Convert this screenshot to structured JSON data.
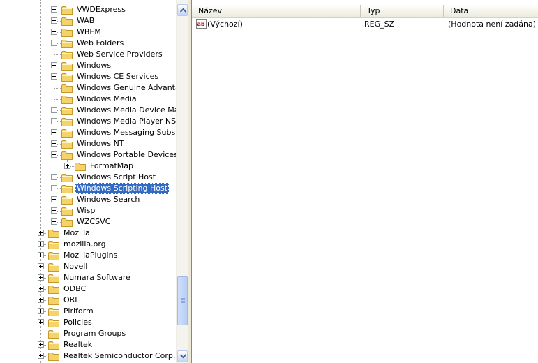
{
  "tree": {
    "nodes": [
      {
        "label": "VWDExpress",
        "depth": 2,
        "expander": "plus"
      },
      {
        "label": "WAB",
        "depth": 2,
        "expander": "plus"
      },
      {
        "label": "WBEM",
        "depth": 2,
        "expander": "plus"
      },
      {
        "label": "Web Folders",
        "depth": 2,
        "expander": "plus"
      },
      {
        "label": "Web Service Providers",
        "depth": 2,
        "expander": "none"
      },
      {
        "label": "Windows",
        "depth": 2,
        "expander": "plus"
      },
      {
        "label": "Windows CE Services",
        "depth": 2,
        "expander": "plus"
      },
      {
        "label": "Windows Genuine Advantage",
        "depth": 2,
        "expander": "none"
      },
      {
        "label": "Windows Media",
        "depth": 2,
        "expander": "none"
      },
      {
        "label": "Windows Media Device Manag",
        "depth": 2,
        "expander": "plus"
      },
      {
        "label": "Windows Media Player NSS",
        "depth": 2,
        "expander": "plus"
      },
      {
        "label": "Windows Messaging Subsyste",
        "depth": 2,
        "expander": "plus"
      },
      {
        "label": "Windows NT",
        "depth": 2,
        "expander": "plus"
      },
      {
        "label": "Windows Portable Devices",
        "depth": 2,
        "expander": "minus"
      },
      {
        "label": "FormatMap",
        "depth": 3,
        "expander": "plus"
      },
      {
        "label": "Windows Script Host",
        "depth": 2,
        "expander": "plus"
      },
      {
        "label": "Windows Scripting Host",
        "depth": 2,
        "expander": "plus",
        "selected": true
      },
      {
        "label": "Windows Search",
        "depth": 2,
        "expander": "plus"
      },
      {
        "label": "Wisp",
        "depth": 2,
        "expander": "plus"
      },
      {
        "label": "WZCSVC",
        "depth": 2,
        "expander": "plus"
      },
      {
        "label": "Mozilla",
        "depth": 1,
        "expander": "plus"
      },
      {
        "label": "mozilla.org",
        "depth": 1,
        "expander": "plus"
      },
      {
        "label": "MozillaPlugins",
        "depth": 1,
        "expander": "plus"
      },
      {
        "label": "Novell",
        "depth": 1,
        "expander": "plus"
      },
      {
        "label": "Numara Software",
        "depth": 1,
        "expander": "plus"
      },
      {
        "label": "ODBC",
        "depth": 1,
        "expander": "plus"
      },
      {
        "label": "ORL",
        "depth": 1,
        "expander": "plus"
      },
      {
        "label": "Piriform",
        "depth": 1,
        "expander": "plus"
      },
      {
        "label": "Policies",
        "depth": 1,
        "expander": "plus"
      },
      {
        "label": "Program Groups",
        "depth": 1,
        "expander": "none"
      },
      {
        "label": "Realtek",
        "depth": 1,
        "expander": "plus"
      },
      {
        "label": "Realtek Semiconductor Corp.",
        "depth": 1,
        "expander": "plus"
      }
    ]
  },
  "list": {
    "columns": {
      "name": "Název",
      "type": "Typ",
      "data": "Data"
    },
    "rows": [
      {
        "name": "(Výchozí)",
        "type": "REG_SZ",
        "data": "(Hodnota není zadána)",
        "icon": "string-value-icon"
      }
    ]
  },
  "colors": {
    "selection": "#316ac5",
    "folder": "#f4d36b",
    "folder_border": "#c49a2c"
  }
}
